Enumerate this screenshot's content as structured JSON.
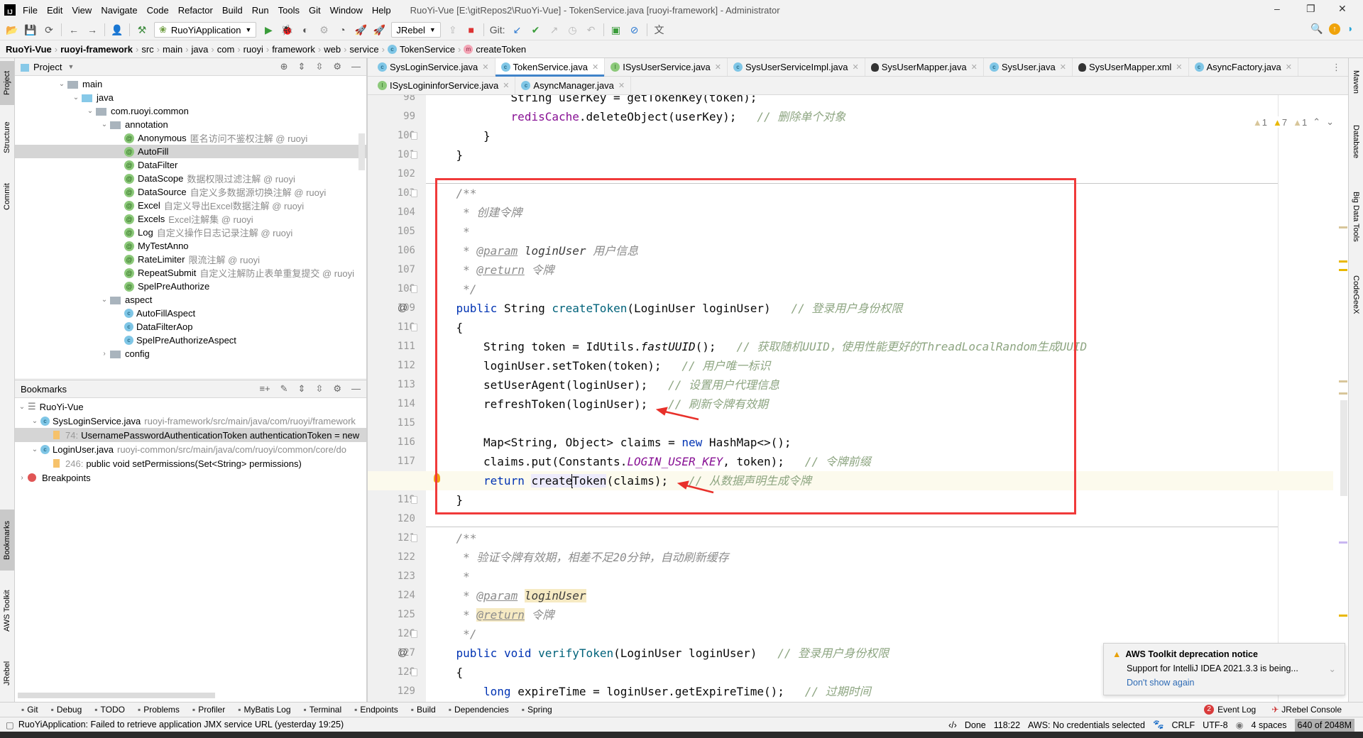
{
  "window": {
    "logo": "IJ",
    "menu": [
      "File",
      "Edit",
      "View",
      "Navigate",
      "Code",
      "Refactor",
      "Build",
      "Run",
      "Tools",
      "Git",
      "Window",
      "Help"
    ],
    "title": "RuoYi-Vue [E:\\gitRepos2\\RuoYi-Vue] - TokenService.java [ruoyi-framework] - Administrator",
    "controls": [
      "–",
      "❐",
      "✕"
    ]
  },
  "toolbar": {
    "run_config": "RuoYiApplication",
    "jrebel": "JRebel",
    "git_label": "Git:"
  },
  "breadcrumb": [
    "RuoYi-Vue",
    "ruoyi-framework",
    "src",
    "main",
    "java",
    "com",
    "ruoyi",
    "framework",
    "web",
    "service",
    "TokenService",
    "createToken"
  ],
  "left_stripe": [
    {
      "label": "Project",
      "selected": true
    },
    {
      "label": "Structure"
    },
    {
      "label": "Commit"
    },
    {
      "label": "Bookmarks",
      "selected": true
    },
    {
      "label": "AWS Toolkit"
    },
    {
      "label": "JRebel"
    }
  ],
  "right_stripe": [
    "Maven",
    "Database",
    "Big Data Tools",
    "CodeGeeX"
  ],
  "project": {
    "title": "Project",
    "tree": [
      {
        "label": "main",
        "depth": 0,
        "icon": "folder",
        "expanded": true
      },
      {
        "label": "java",
        "depth": 1,
        "icon": "source-folder",
        "expanded": true
      },
      {
        "label": "com.ruoyi.common",
        "depth": 2,
        "icon": "package",
        "expanded": true
      },
      {
        "label": "annotation",
        "depth": 3,
        "icon": "package",
        "expanded": true
      },
      {
        "label": "Anonymous",
        "hint": "匿名访问不鉴权注解 @ ruoyi",
        "depth": 4,
        "icon": "annotation"
      },
      {
        "label": "AutoFill",
        "depth": 4,
        "icon": "annotation",
        "selected": true
      },
      {
        "label": "DataFilter",
        "depth": 4,
        "icon": "annotation"
      },
      {
        "label": "DataScope",
        "hint": "数据权限过滤注解 @ ruoyi",
        "depth": 4,
        "icon": "annotation"
      },
      {
        "label": "DataSource",
        "hint": "自定义多数据源切换注解 @ ruoyi",
        "depth": 4,
        "icon": "annotation"
      },
      {
        "label": "Excel",
        "hint": "自定义导出Excel数据注解 @ ruoyi",
        "depth": 4,
        "icon": "annotation"
      },
      {
        "label": "Excels",
        "hint": "Excel注解集 @ ruoyi",
        "depth": 4,
        "icon": "annotation"
      },
      {
        "label": "Log",
        "hint": "自定义操作日志记录注解 @ ruoyi",
        "depth": 4,
        "icon": "annotation"
      },
      {
        "label": "MyTestAnno",
        "depth": 4,
        "icon": "annotation"
      },
      {
        "label": "RateLimiter",
        "hint": "限流注解 @ ruoyi",
        "depth": 4,
        "icon": "annotation"
      },
      {
        "label": "RepeatSubmit",
        "hint": "自定义注解防止表单重复提交 @ ruoyi",
        "depth": 4,
        "icon": "annotation"
      },
      {
        "label": "SpelPreAuthorize",
        "depth": 4,
        "icon": "annotation"
      },
      {
        "label": "aspect",
        "depth": 3,
        "icon": "package",
        "expanded": true
      },
      {
        "label": "AutoFillAspect",
        "depth": 4,
        "icon": "class"
      },
      {
        "label": "DataFilterAop",
        "depth": 4,
        "icon": "class"
      },
      {
        "label": "SpelPreAuthorizeAspect",
        "depth": 4,
        "icon": "class"
      },
      {
        "label": "config",
        "depth": 3,
        "icon": "package",
        "expanded": false
      }
    ]
  },
  "bookmarks": {
    "title": "Bookmarks",
    "rows": [
      {
        "label": "RuoYi-Vue",
        "depth": 0,
        "icon": "list",
        "expanded": true
      },
      {
        "label": "SysLoginService.java",
        "hint": "ruoyi-framework/src/main/java/com/ruoyi/framework",
        "depth": 1,
        "icon": "class",
        "expanded": true
      },
      {
        "label": "UsernamePasswordAuthenticationToken authenticationToken = new",
        "line": "74:",
        "depth": 2,
        "icon": "bookmark",
        "selected": true
      },
      {
        "label": "LoginUser.java",
        "hint": "ruoyi-common/src/main/java/com/ruoyi/common/core/do",
        "depth": 1,
        "icon": "class",
        "expanded": true
      },
      {
        "label": "public void setPermissions(Set<String> permissions)",
        "line": "246:",
        "depth": 2,
        "icon": "bookmark"
      },
      {
        "label": "Breakpoints",
        "depth": 0,
        "icon": "breakpoint",
        "expanded": false
      }
    ]
  },
  "editor": {
    "tabs_row1": [
      {
        "label": "SysLoginService.java",
        "icon": "class"
      },
      {
        "label": "TokenService.java",
        "icon": "class",
        "active": true
      },
      {
        "label": "ISysUserService.java",
        "icon": "interface"
      },
      {
        "label": "SysUserServiceImpl.java",
        "icon": "class"
      },
      {
        "label": "SysUserMapper.java",
        "icon": "mybatis"
      },
      {
        "label": "SysUser.java",
        "icon": "class"
      },
      {
        "label": "SysUserMapper.xml",
        "icon": "mybatis"
      },
      {
        "label": "AsyncFactory.java",
        "icon": "class"
      }
    ],
    "tabs_row2": [
      {
        "label": "ISysLogininforService.java",
        "icon": "interface"
      },
      {
        "label": "AsyncManager.java",
        "icon": "class"
      }
    ],
    "inspections": [
      {
        "icon": "weak-warning-icon",
        "count": "1"
      },
      {
        "icon": "warning-icon",
        "count": "7"
      },
      {
        "icon": "weak-warning-icon",
        "count": "1"
      }
    ],
    "lines": [
      {
        "n": 98,
        "i": 12,
        "s": [
          [
            "String userKey = getTokenKey(token);",
            ""
          ]
        ]
      },
      {
        "n": 99,
        "i": 12,
        "s": [
          [
            "redisCache",
            "fd"
          ],
          [
            ".deleteObject(userKey);   ",
            ""
          ],
          [
            "// 删除单个对象",
            "cm"
          ]
        ]
      },
      {
        "n": 100,
        "i": 8,
        "s": [
          [
            "}",
            ""
          ]
        ],
        "fold": true
      },
      {
        "n": 101,
        "i": 4,
        "s": [
          [
            "}",
            ""
          ]
        ],
        "fold": true
      },
      {
        "n": 102,
        "i": 0,
        "s": []
      },
      {
        "n": 103,
        "i": 4,
        "s": [
          [
            "/**",
            "dc"
          ]
        ],
        "fold": true
      },
      {
        "n": 104,
        "i": 5,
        "s": [
          [
            "* 创建令牌",
            "dc"
          ]
        ]
      },
      {
        "n": 105,
        "i": 5,
        "s": [
          [
            "*",
            "dc"
          ]
        ]
      },
      {
        "n": 106,
        "i": 5,
        "s": [
          [
            "* ",
            "dc"
          ],
          [
            "@param",
            "dt"
          ],
          [
            " ",
            "dc"
          ],
          [
            "loginUser",
            "dp"
          ],
          [
            " 用户信息",
            "dc"
          ]
        ]
      },
      {
        "n": 107,
        "i": 5,
        "s": [
          [
            "* ",
            "dc"
          ],
          [
            "@return",
            "dt"
          ],
          [
            " 令牌",
            "dc"
          ]
        ]
      },
      {
        "n": 108,
        "i": 5,
        "s": [
          [
            "*/",
            "dc"
          ]
        ],
        "fold": true
      },
      {
        "n": 109,
        "i": 4,
        "s": [
          [
            "public",
            "kw"
          ],
          [
            " String ",
            ""
          ],
          [
            "createToken",
            "md"
          ],
          [
            "(LoginUser loginUser)   ",
            ""
          ],
          [
            "// 登录用户身份权限",
            "cm"
          ]
        ],
        "marker": "@"
      },
      {
        "n": 110,
        "i": 4,
        "s": [
          [
            "{",
            ""
          ]
        ],
        "fold": true
      },
      {
        "n": 111,
        "i": 8,
        "s": [
          [
            "String token = IdUtils.",
            ""
          ],
          [
            "fastUUID",
            "it"
          ],
          [
            "();   ",
            ""
          ],
          [
            "// 获取随机UUID，使用性能更好的ThreadLocalRandom生成UUID",
            "cm"
          ]
        ]
      },
      {
        "n": 112,
        "i": 8,
        "s": [
          [
            "loginUser.setToken(token);   ",
            ""
          ],
          [
            "// 用户唯一标识",
            "cm"
          ]
        ]
      },
      {
        "n": 113,
        "i": 8,
        "s": [
          [
            "setUserAgent(loginUser);   ",
            ""
          ],
          [
            "// 设置用户代理信息",
            "cm"
          ]
        ]
      },
      {
        "n": 114,
        "i": 8,
        "s": [
          [
            "refreshToken(loginUser);   ",
            ""
          ],
          [
            "// 刷新令牌有效期",
            "cm"
          ]
        ]
      },
      {
        "n": 115,
        "i": 0,
        "s": []
      },
      {
        "n": 116,
        "i": 8,
        "s": [
          [
            "Map<String, Object> claims = ",
            ""
          ],
          [
            "new",
            "kw"
          ],
          [
            " HashMap<>();",
            ""
          ]
        ]
      },
      {
        "n": 117,
        "i": 8,
        "s": [
          [
            "claims.put(Constants.",
            ""
          ],
          [
            "LOGIN_USER_KEY",
            "st"
          ],
          [
            ", token);   ",
            ""
          ],
          [
            "// 令牌前缀",
            "cm"
          ]
        ]
      },
      {
        "n": 118,
        "i": 8,
        "s": [
          [
            "return",
            "kw"
          ],
          [
            " ",
            ""
          ],
          [
            "create",
            "hlr"
          ],
          [
            "|caret",
            ""
          ],
          [
            "Token",
            "hlr"
          ],
          [
            "(claims);   ",
            ""
          ],
          [
            "// 从数据声明生成令牌",
            "cm"
          ]
        ],
        "current": true,
        "marker": "bulb"
      },
      {
        "n": 119,
        "i": 4,
        "s": [
          [
            "}",
            ""
          ]
        ],
        "fold": true
      },
      {
        "n": 120,
        "i": 0,
        "s": []
      },
      {
        "n": 121,
        "i": 4,
        "s": [
          [
            "/**",
            "dc"
          ]
        ],
        "fold": true
      },
      {
        "n": 122,
        "i": 5,
        "s": [
          [
            "* 验证令牌有效期，相差不足20分钟，自动刷新缓存",
            "dc"
          ]
        ]
      },
      {
        "n": 123,
        "i": 5,
        "s": [
          [
            "*",
            "dc"
          ]
        ]
      },
      {
        "n": 124,
        "i": 5,
        "s": [
          [
            "* ",
            "dc"
          ],
          [
            "@param",
            "dt"
          ],
          [
            " ",
            "dc"
          ],
          [
            "loginUser",
            "dp hly"
          ]
        ]
      },
      {
        "n": 125,
        "i": 5,
        "s": [
          [
            "* ",
            "dc"
          ],
          [
            "@return",
            "dt hly"
          ],
          [
            " 令牌",
            "dc"
          ]
        ]
      },
      {
        "n": 126,
        "i": 5,
        "s": [
          [
            "*/",
            "dc"
          ]
        ],
        "fold": true
      },
      {
        "n": 127,
        "i": 4,
        "s": [
          [
            "public",
            "kw"
          ],
          [
            " ",
            ""
          ],
          [
            "void",
            "kw"
          ],
          [
            " ",
            ""
          ],
          [
            "verifyToken",
            "md"
          ],
          [
            "(LoginUser loginUser)   ",
            ""
          ],
          [
            "// 登录用户身份权限",
            "cm"
          ]
        ],
        "marker": "@"
      },
      {
        "n": 128,
        "i": 4,
        "s": [
          [
            "{",
            ""
          ]
        ],
        "fold": true
      },
      {
        "n": 129,
        "i": 8,
        "s": [
          [
            "long",
            "kw"
          ],
          [
            " expireTime = loginUser.getExpireTime();   ",
            ""
          ],
          [
            "// 过期时间",
            "cm"
          ]
        ]
      }
    ]
  },
  "notification": {
    "title": "AWS Toolkit deprecation notice",
    "body": "Support for IntelliJ IDEA 2021.3.3 is being...",
    "action": "Don't show again"
  },
  "tool_windows": [
    {
      "label": "Git",
      "icon": "git-icon"
    },
    {
      "label": "Debug",
      "icon": "bug-icon"
    },
    {
      "label": "TODO",
      "icon": "todo-icon"
    },
    {
      "label": "Problems",
      "icon": "problems-icon"
    },
    {
      "label": "Profiler",
      "icon": "profiler-icon"
    },
    {
      "label": "MyBatis Log",
      "icon": "mybatis-icon"
    },
    {
      "label": "Terminal",
      "icon": "terminal-icon"
    },
    {
      "label": "Endpoints",
      "icon": "endpoints-icon"
    },
    {
      "label": "Build",
      "icon": "hammer-icon"
    },
    {
      "label": "Dependencies",
      "icon": "dependencies-icon"
    },
    {
      "label": "Spring",
      "icon": "spring-icon"
    }
  ],
  "right_tool_windows": [
    {
      "label": "Event Log",
      "badge": "2"
    },
    {
      "label": "JRebel Console"
    }
  ],
  "status": {
    "message": "RuoYiApplication: Failed to retrieve application JMX service URL (yesterday 19:25)",
    "vcs": "Done",
    "position": "118:22",
    "aws": "AWS: No credentials selected",
    "line_sep": "CRLF",
    "encoding": "UTF-8",
    "indent": "4 spaces",
    "memory": "640 of 2048M",
    "memory_used": "640",
    "memory_total": "2048"
  },
  "colors": {
    "accent": "#4083c9",
    "annotation_box": "#f03a3a",
    "keyword": "#0033b3",
    "comment": "#8da581"
  }
}
